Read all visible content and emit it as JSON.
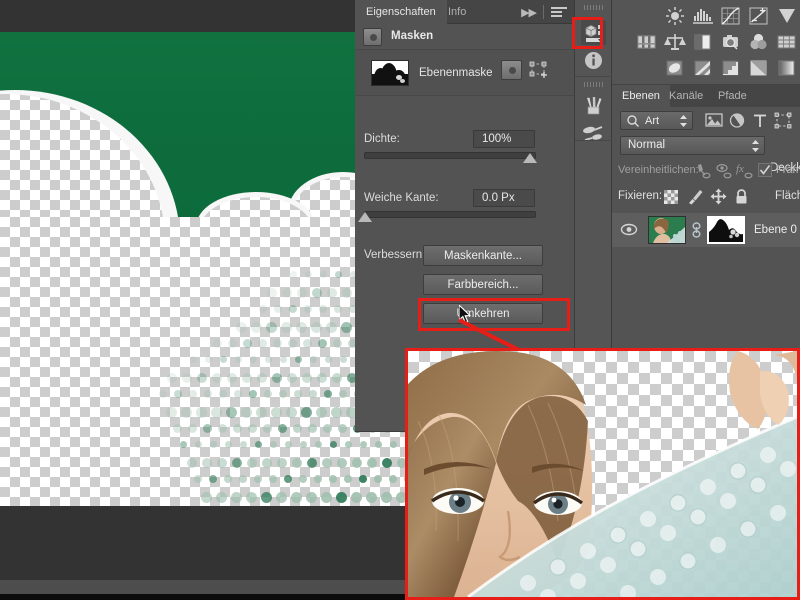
{
  "app": {
    "name": "Adobe Photoshop",
    "language": "de"
  },
  "properties_panel": {
    "tabs": [
      {
        "label": "Eigenschaften",
        "active": true
      },
      {
        "label": "Info",
        "active": false
      }
    ],
    "expand_icon": "double-chevron-right-icon",
    "menu_icon": "panel-menu-icon",
    "header": {
      "title": "Masken",
      "icon": "pixel-mask-icon"
    },
    "mask_row": {
      "label": "Ebenenmaske",
      "pixel_mask_icon": "pixel-mask-icon",
      "vector_mask_icon": "vector-mask-icon"
    },
    "density": {
      "label": "Dichte:",
      "value": "100%",
      "slider_percent": 100
    },
    "feather": {
      "label": "Weiche Kante:",
      "value": "0.0 Px",
      "slider_percent": 0
    },
    "refine": {
      "label": "Verbessern:",
      "buttons": [
        {
          "label": "Maskenkante...",
          "highlighted": false
        },
        {
          "label": "Farbbereich...",
          "highlighted": false
        },
        {
          "label": "Umkehren",
          "highlighted": true
        }
      ]
    }
  },
  "icon_dock": {
    "items": [
      {
        "name": "properties-masks-icon",
        "active": true,
        "highlighted": true
      },
      {
        "name": "info-icon",
        "active": false,
        "highlighted": false
      },
      {
        "name": "brushes-icon",
        "active": false,
        "highlighted": false
      },
      {
        "name": "brush-presets-icon",
        "active": false,
        "highlighted": false
      }
    ]
  },
  "adjustments_panel": {
    "icons": [
      "brightness-contrast-icon",
      "levels-icon",
      "curves-icon",
      "exposure-icon",
      "vibrance-icon",
      "hue-saturation-icon",
      "color-balance-icon",
      "black-white-icon",
      "photo-filter-icon",
      "channel-mixer-icon",
      "color-lookup-icon",
      "invert-icon",
      "posterize-icon",
      "threshold-icon",
      "selective-color-icon",
      "gradient-map-icon"
    ]
  },
  "layers_panel": {
    "tabs": [
      {
        "label": "Ebenen",
        "active": true
      },
      {
        "label": "Kanäle",
        "active": false
      },
      {
        "label": "Pfade",
        "active": false
      }
    ],
    "filter": {
      "search_icon": "search-icon",
      "value": "Art",
      "stepper_icon": "stepper-arrows-icon",
      "type_icons": [
        "image-filter-icon",
        "adjustment-filter-icon",
        "text-filter-icon",
        "shape-filter-icon"
      ]
    },
    "blend_mode": {
      "value": "Normal",
      "stepper_icon": "stepper-arrows-icon"
    },
    "opacity_label": "Deckkra",
    "unify": {
      "label": "Vereinheitlichen:",
      "icons": [
        "unify-position-icon",
        "unify-visibility-icon",
        "unify-effects-icon"
      ],
      "frame_label": "Frame",
      "frame_checked": true
    },
    "lock": {
      "label": "Fixieren:",
      "icons": [
        "lock-transparency-icon",
        "lock-image-icon",
        "lock-position-icon",
        "lock-all-icon"
      ],
      "fill_label": "Fläch"
    },
    "layers": [
      {
        "name": "Ebene 0",
        "visible": true,
        "visibility_icon": "eye-icon",
        "link_icon": "link-icon",
        "mask_selected": true
      }
    ]
  },
  "canvas": {
    "document_description": "Freigestelltes Bild auf Transparenz-Schachbrett mit grünem Hintergrundrest",
    "background_color": "#0e6d3d",
    "transparency_checker_light": "#ffffff",
    "transparency_checker_dark": "#cdcdcd"
  },
  "callout": {
    "arrow_color": "#e71d18",
    "highlight_color": "#e71d18",
    "inset_description": "Zoom-Ansicht: Frau mit Luftpolsterfolie freigestellt auf Transparenz"
  }
}
